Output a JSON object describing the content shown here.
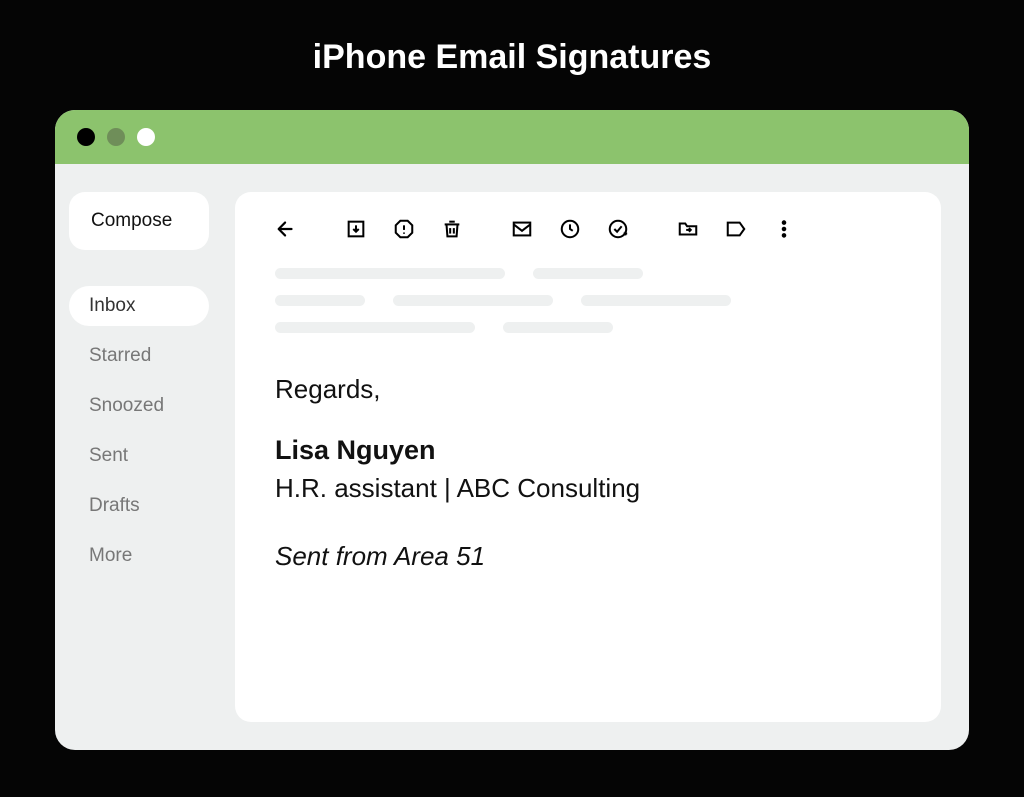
{
  "page_title": "iPhone Email Signatures",
  "colors": {
    "titlebar": "#8cc36d",
    "placeholder": "#eef0f0"
  },
  "sidebar": {
    "compose_label": "Compose",
    "items": [
      {
        "label": "Inbox",
        "active": true
      },
      {
        "label": "Starred",
        "active": false
      },
      {
        "label": "Snoozed",
        "active": false
      },
      {
        "label": "Sent",
        "active": false
      },
      {
        "label": "Drafts",
        "active": false
      },
      {
        "label": "More",
        "active": false
      }
    ]
  },
  "toolbar": {
    "icons": [
      "back-arrow-icon",
      "archive-icon",
      "report-spam-icon",
      "delete-icon",
      "mark-unread-icon",
      "snooze-icon",
      "add-to-tasks-icon",
      "move-to-icon",
      "labels-icon",
      "more-icon"
    ]
  },
  "signature": {
    "regards": "Regards,",
    "name": "Lisa Nguyen",
    "role": "H.R. assistant | ABC Consulting",
    "sent_from": "Sent from Area 51"
  }
}
